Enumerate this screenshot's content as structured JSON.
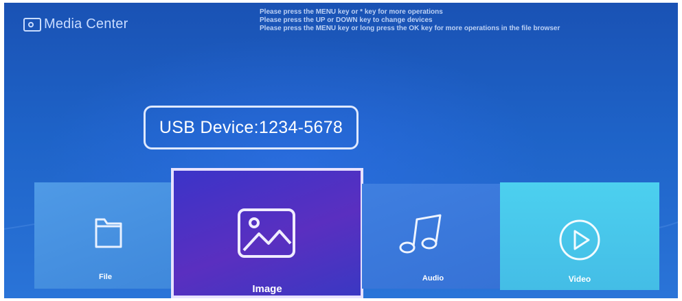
{
  "app": {
    "title": "Media Center",
    "logo_icon": "media-center-logo-icon"
  },
  "hints": [
    "Please press the MENU key or * key for more operations",
    "Please press the UP or DOWN key to change devices",
    "Please press the MENU key or long press the OK key for more operations in the file browser"
  ],
  "device": {
    "label": "USB Device:1234-5678"
  },
  "tiles": [
    {
      "label": "File",
      "icon": "folder-icon",
      "selected": false
    },
    {
      "label": "Image",
      "icon": "image-icon",
      "selected": true
    },
    {
      "label": "Audio",
      "icon": "music-note-icon",
      "selected": false
    },
    {
      "label": "Video",
      "icon": "play-circle-icon",
      "selected": false
    }
  ],
  "colors": {
    "background": "#1e63c8",
    "tile_file": "#4592e0",
    "tile_image": "#4a32c4",
    "tile_audio": "#3a78dc",
    "tile_video": "#48c8eb",
    "selection_border": "#e7e2ff"
  }
}
